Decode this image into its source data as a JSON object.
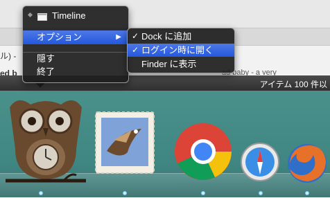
{
  "background": {
    "line1": "ル) - ",
    "line2": "ed b",
    "line2_right": "ad baby - a very"
  },
  "items_bar": {
    "count_label": "アイテム 100 件以"
  },
  "menu": {
    "title": "Timeline",
    "options_label": "オプション",
    "hide_label": "隠す",
    "quit_label": "終了"
  },
  "submenu": {
    "dock_label": "Dock に追加",
    "login_label": "ログイン時に開く",
    "finder_label": "Finder に表示"
  },
  "dock": {
    "icons": [
      "owl-timeline-icon",
      "mail-icon",
      "chrome-icon",
      "safari-icon",
      "firefox-icon"
    ]
  },
  "colors": {
    "menu_highlight": "#2f63de",
    "dock_bg": "#438a86"
  }
}
